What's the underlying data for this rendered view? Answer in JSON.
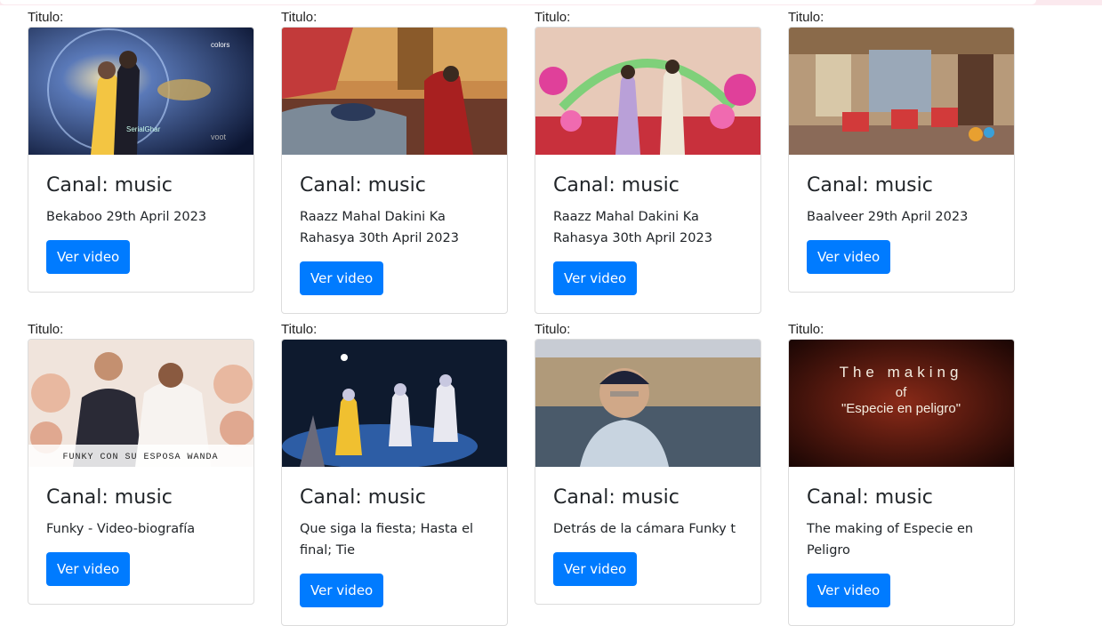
{
  "items": [
    {
      "label": "Titulo:",
      "channel": "Canal: music",
      "desc": "Bekaboo 29th April 2023",
      "button": "Ver video",
      "thumb_icon": "couple-cosmic-thumbnail"
    },
    {
      "label": "Titulo:",
      "channel": "Canal: music",
      "desc": "Raazz Mahal Dakini Ka Rahasya 30th April 2023",
      "button": "Ver video",
      "thumb_icon": "palace-bedroom-thumbnail"
    },
    {
      "label": "Titulo:",
      "channel": "Canal: music",
      "desc": "Raazz Mahal Dakini Ka Rahasya 30th April 2023",
      "button": "Ver video",
      "thumb_icon": "wedding-flowers-thumbnail"
    },
    {
      "label": "Titulo:",
      "channel": "Canal: music",
      "desc": "Baalveer 29th April 2023",
      "button": "Ver video",
      "thumb_icon": "palace-hall-thumbnail"
    },
    {
      "label": "Titulo:",
      "channel": "Canal: music",
      "desc": "Funky - Video-biografía",
      "button": "Ver video",
      "thumb_icon": "wedding-photo-thumbnail",
      "thumb_caption": "FUNKY CON SU ESPOSA WANDA"
    },
    {
      "label": "Titulo:",
      "channel": "Canal: music",
      "desc": "Que siga la fiesta; Hasta el final; Tie",
      "button": "Ver video",
      "thumb_icon": "dancers-stage-thumbnail"
    },
    {
      "label": "Titulo:",
      "channel": "Canal: music",
      "desc": "Detrás de la cámara Funky t",
      "button": "Ver video",
      "thumb_icon": "man-river-thumbnail"
    },
    {
      "label": "Titulo:",
      "channel": "Canal: music",
      "desc": "The making of Especie en Peligro",
      "button": "Ver video",
      "thumb_icon": "title-card-thumbnail",
      "thumb_caption": "The making of \"Especie en peligro\""
    }
  ]
}
